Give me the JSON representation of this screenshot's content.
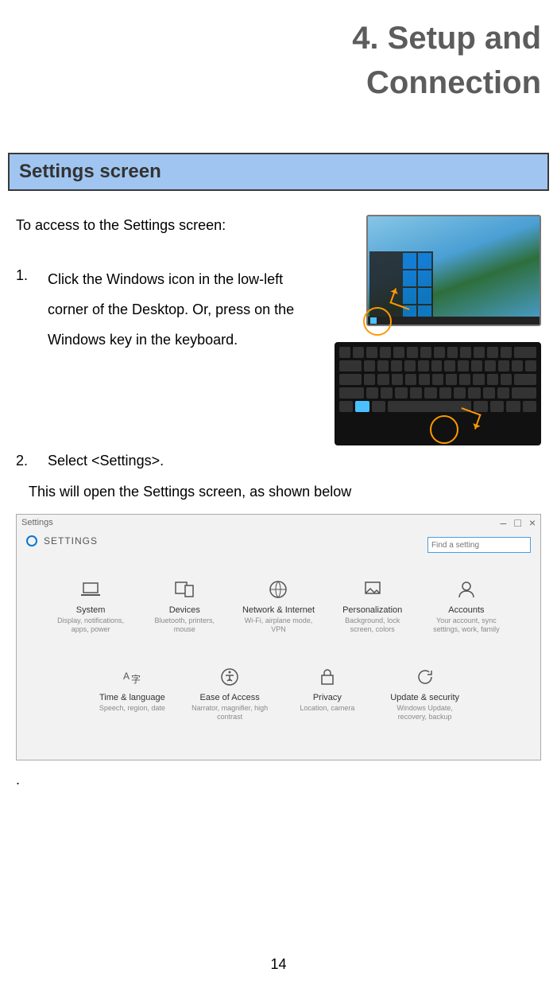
{
  "title_line1": "4. Setup and",
  "title_line2": "Connection",
  "section_header": "Settings screen",
  "intro": "To access to the Settings screen:",
  "step1_num": "1.",
  "step1_text": "Click the Windows icon in the low-left corner of the Desktop. Or, press on the Windows key in the keyboard.",
  "step2_num": "2.",
  "step2_text": "Select <Settings>.",
  "note": "This will open the Settings screen, as shown below",
  "dot": ".",
  "page_number": "14",
  "settings_window": {
    "back_label": "←",
    "title": "Settings",
    "settings_label": "SETTINGS",
    "search_placeholder": "Find a setting",
    "minimize": "–",
    "maximize": "□",
    "close": "×",
    "tiles_row1": [
      {
        "name": "System",
        "desc": "Display, notifications, apps, power"
      },
      {
        "name": "Devices",
        "desc": "Bluetooth, printers, mouse"
      },
      {
        "name": "Network & Internet",
        "desc": "Wi-Fi, airplane mode, VPN"
      },
      {
        "name": "Personalization",
        "desc": "Background, lock screen, colors"
      },
      {
        "name": "Accounts",
        "desc": "Your account, sync settings, work, family"
      }
    ],
    "tiles_row2": [
      {
        "name": "Time & language",
        "desc": "Speech, region, date"
      },
      {
        "name": "Ease of Access",
        "desc": "Narrator, magnifier, high contrast"
      },
      {
        "name": "Privacy",
        "desc": "Location, camera"
      },
      {
        "name": "Update & security",
        "desc": "Windows Update, recovery, backup"
      }
    ]
  }
}
